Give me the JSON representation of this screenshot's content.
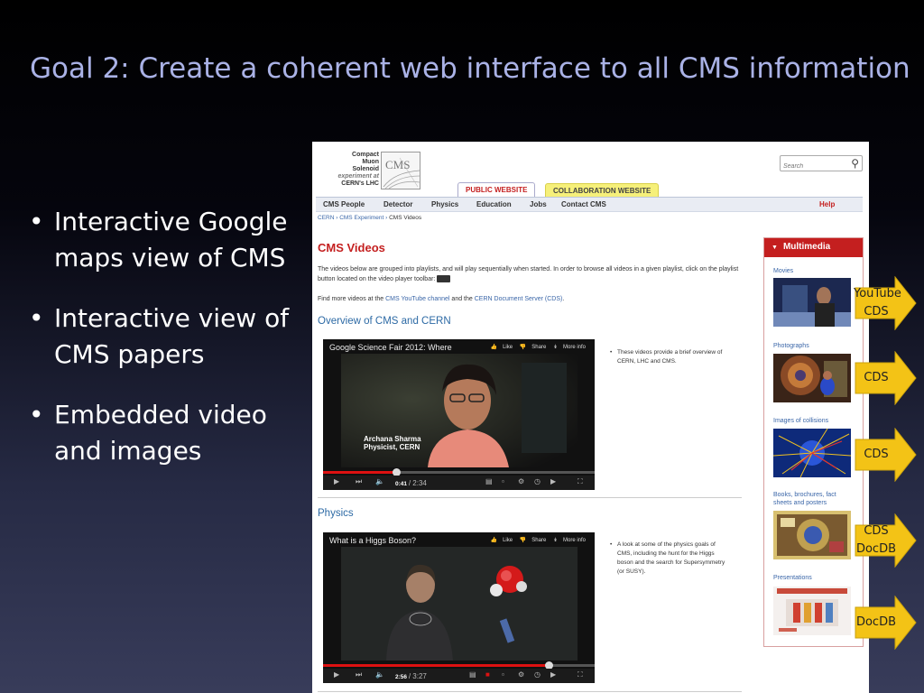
{
  "slide": {
    "title": "Goal 2:  Create a coherent web interface to all CMS information",
    "bullets": [
      "Interactive Google maps view of CMS",
      "Interactive view of CMS papers",
      "Embedded video and images"
    ]
  },
  "site": {
    "logo": {
      "line1": "Compact",
      "line2": "Muon",
      "line3": "Solenoid",
      "line4": "experiment at",
      "line5": "CERN's LHC",
      "mark": "CMS"
    },
    "search_placeholder": "Search",
    "tabs": {
      "public": "PUBLIC WEBSITE",
      "collaboration": "COLLABORATION WEBSITE"
    },
    "nav": [
      "CMS People",
      "Detector",
      "Physics",
      "Education",
      "Jobs",
      "Contact CMS"
    ],
    "nav_help": "Help",
    "breadcrumb": {
      "b1": "CERN",
      "b2": "CMS Experiment",
      "current": "CMS Videos"
    },
    "page_title": "CMS Videos",
    "intro": "The videos below are grouped into playlists, and will play sequentially when started. In order to browse all videos in a given playlist, click on the playlist button located on the video player toolbar:",
    "links": {
      "prefix": "Find more videos at the",
      "youtube": "CMS YouTube channel",
      "middle": "and the",
      "cds": "CERN Document Server (CDS)",
      "suffix": "."
    },
    "sections": [
      {
        "title": "Overview of CMS and CERN",
        "video_title": "Google Science Fair 2012:  Where",
        "overlay_name": "Archana Sharma",
        "overlay_role": "Physicist, CERN",
        "time_current": "0:41",
        "time_total": "/ 2:34",
        "progress": 0.27,
        "description": "These videos provide a brief overview of CERN, LHC and CMS."
      },
      {
        "title": "Physics",
        "video_title": "What is a Higgs Boson?",
        "time_current": "2:56",
        "time_total": "/ 3:27",
        "progress": 0.83,
        "description": "A look at some of the physics goals of CMS, including the hunt for the Higgs boson and the search for Supersymmetry (or SUSY)."
      }
    ],
    "video_buttons": {
      "like": "Like",
      "share": "Share",
      "more": "More info"
    },
    "multimedia": {
      "title": "Multimedia",
      "items": [
        {
          "label": "Movies"
        },
        {
          "label": "Photographs"
        },
        {
          "label": "Images of collisions"
        },
        {
          "label": "Books, brochures, fact sheets and posters"
        },
        {
          "label": "Presentations"
        }
      ]
    }
  },
  "callouts": [
    {
      "line1": "YouTube",
      "line2": "CDS"
    },
    {
      "line1": "CDS"
    },
    {
      "line1": "CDS"
    },
    {
      "line1": "CDS",
      "line2": "DocDB"
    },
    {
      "line1": "DocDB"
    }
  ],
  "colors": {
    "accent_red": "#c41f1f",
    "link_blue": "#3a66a8",
    "callout_gold": "#f3c316",
    "title_lavender": "#aab2e6"
  }
}
